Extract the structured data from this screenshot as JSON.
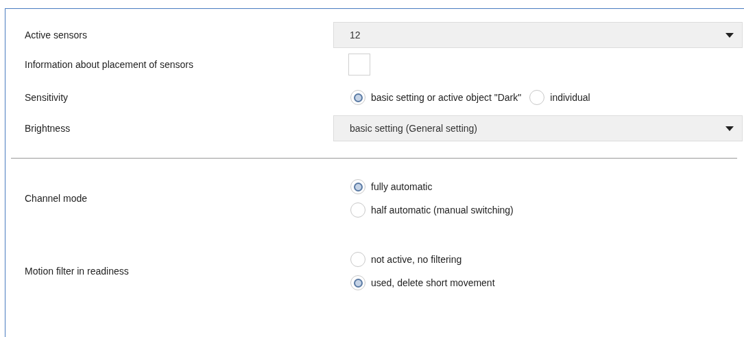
{
  "settings": [
    {
      "kind": "dropdown",
      "label": "Active sensors",
      "value": "12"
    },
    {
      "kind": "checkbox",
      "label": "Information about placement of sensors",
      "checked": false
    },
    {
      "kind": "radio_inline",
      "label": "Sensitivity",
      "options": [
        {
          "label": "basic setting or active object \"Dark\"",
          "selected": true
        },
        {
          "label": "individual",
          "selected": false
        }
      ]
    },
    {
      "kind": "dropdown",
      "label": "Brightness",
      "value": "basic setting (General setting)"
    },
    {
      "kind": "divider"
    },
    {
      "kind": "radio_stacked",
      "label": "Channel mode",
      "options": [
        {
          "label": "fully automatic",
          "selected": true
        },
        {
          "label": "half automatic (manual switching)",
          "selected": false
        }
      ]
    },
    {
      "kind": "radio_stacked",
      "label": "Motion filter in readiness",
      "options": [
        {
          "label": "not active, no filtering",
          "selected": false
        },
        {
          "label": "used, delete short movement",
          "selected": true
        }
      ]
    }
  ]
}
